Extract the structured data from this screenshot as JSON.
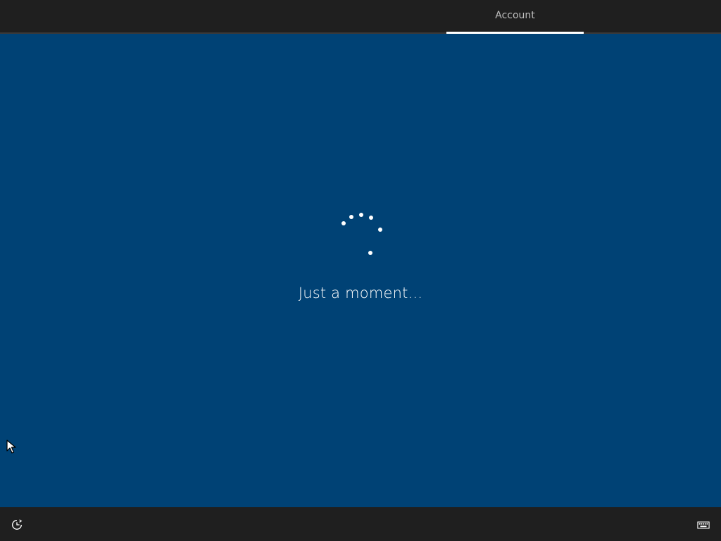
{
  "header": {
    "tabs": [
      {
        "label": "Account",
        "selected": true
      }
    ]
  },
  "main": {
    "status_text": "Just a moment..."
  },
  "footer": {
    "left_icon": "ease-of-access-icon",
    "right_icon": "keyboard-icon"
  },
  "colors": {
    "background": "#004275",
    "bars": "#1f1f1f",
    "text": "#ffffff",
    "tab_text": "#bdbdbd"
  }
}
